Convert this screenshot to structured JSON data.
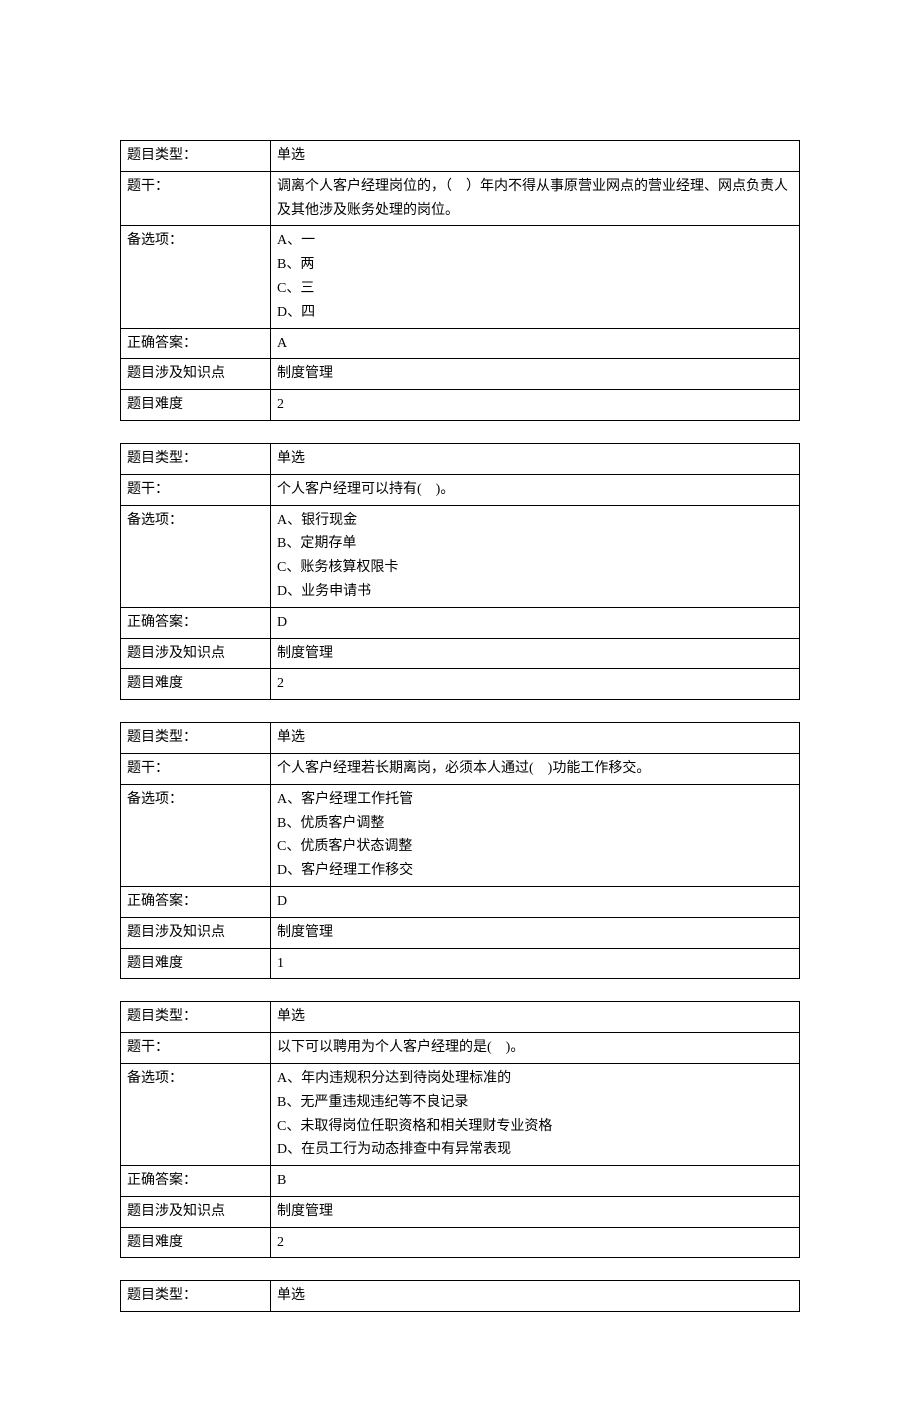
{
  "labels": {
    "type": "题目类型：",
    "stem": "题干：",
    "options": "备选项：",
    "answer": "正确答案：",
    "point": "题目涉及知识点",
    "difficulty": "题目难度"
  },
  "questions": [
    {
      "type": "单选",
      "stem": "调离个人客户经理岗位的，（　）年内不得从事原营业网点的营业经理、网点负责人及其他涉及账务处理的岗位。",
      "options": [
        "A、一",
        "B、两",
        "C、三",
        "D、四"
      ],
      "answer": "A",
      "point": "制度管理",
      "difficulty": "2"
    },
    {
      "type": "单选",
      "stem": "个人客户经理可以持有(　)。",
      "options": [
        "A、银行现金",
        "B、定期存单",
        "C、账务核算权限卡",
        "D、业务申请书"
      ],
      "answer": "D",
      "point": "制度管理",
      "difficulty": "2"
    },
    {
      "type": "单选",
      "stem": "个人客户经理若长期离岗，必须本人通过(　)功能工作移交。",
      "options": [
        "A、客户经理工作托管",
        "B、优质客户调整",
        "C、优质客户状态调整",
        "D、客户经理工作移交"
      ],
      "answer": "D",
      "point": "制度管理",
      "difficulty": "1"
    },
    {
      "type": "单选",
      "stem": "以下可以聘用为个人客户经理的是(　)。",
      "options": [
        "A、年内违规积分达到待岗处理标准的",
        "B、无严重违规违纪等不良记录",
        "C、未取得岗位任职资格和相关理财专业资格",
        "D、在员工行为动态排查中有异常表现"
      ],
      "answer": "B",
      "point": "制度管理",
      "difficulty": "2"
    },
    {
      "type": "单选"
    }
  ]
}
